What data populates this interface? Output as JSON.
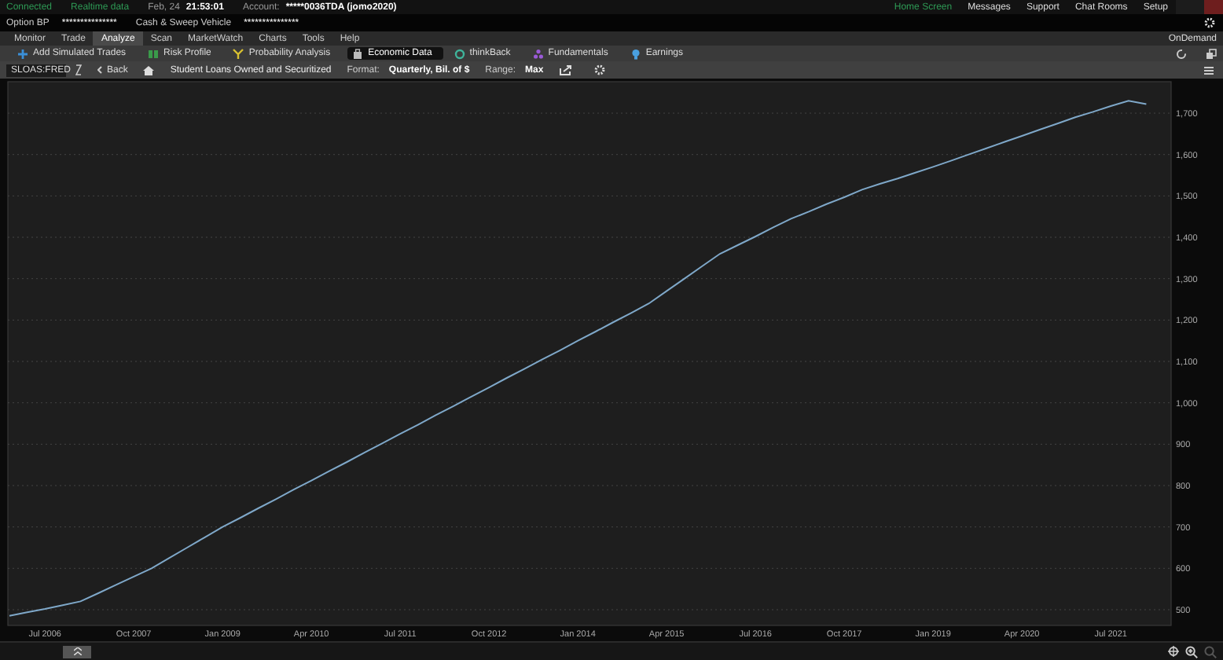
{
  "status_bar": {
    "connection": "Connected",
    "feed": "Realtime data",
    "date": "Feb, 24",
    "time": "21:53:01",
    "account_label": "Account:",
    "account": "*****0036TDA (jomo2020)",
    "links": [
      {
        "label": "Home Screen",
        "selected": true
      },
      {
        "label": "Messages",
        "selected": false
      },
      {
        "label": "Support",
        "selected": false
      },
      {
        "label": "Chat Rooms",
        "selected": false
      },
      {
        "label": "Setup",
        "selected": false
      }
    ]
  },
  "balances": [
    {
      "label": "Option BP",
      "value": "***************"
    },
    {
      "label": "Cash & Sweep Vehicle",
      "value": "***************"
    }
  ],
  "tabs": [
    {
      "label": "Monitor",
      "selected": false
    },
    {
      "label": "Trade",
      "selected": false
    },
    {
      "label": "Analyze",
      "selected": true
    },
    {
      "label": "Scan",
      "selected": false
    },
    {
      "label": "MarketWatch",
      "selected": false
    },
    {
      "label": "Charts",
      "selected": false
    },
    {
      "label": "Tools",
      "selected": false
    },
    {
      "label": "Help",
      "selected": false
    }
  ],
  "on_demand": "OnDemand",
  "subtabs": [
    {
      "label": "Add Simulated Trades",
      "kind": "plus",
      "selected": false
    },
    {
      "label": "Risk Profile",
      "kind": "bars",
      "selected": false
    },
    {
      "label": "Probability Analysis",
      "kind": "fork",
      "selected": false
    },
    {
      "label": "Economic Data",
      "kind": "case",
      "selected": true
    },
    {
      "label": "thinkBack",
      "kind": "ring",
      "selected": false
    },
    {
      "label": "Fundamentals",
      "kind": "dots",
      "selected": false
    },
    {
      "label": "Earnings",
      "kind": "bulb",
      "selected": false
    }
  ],
  "chart_toolbar": {
    "symbol": "SLOAS:FRED",
    "back": "Back",
    "title": "Student Loans Owned and Securitized",
    "format_label": "Format:",
    "format": "Quarterly, Bil. of $",
    "range_label": "Range:",
    "range": "Max"
  },
  "chart": {
    "chart_data": {
      "type": "line",
      "ylim": [
        462,
        1776
      ],
      "yticks": [
        {
          "value": 500,
          "label": "500"
        },
        {
          "value": 600,
          "label": "600"
        },
        {
          "value": 700,
          "label": "700"
        },
        {
          "value": 800,
          "label": "800"
        },
        {
          "value": 900,
          "label": "900"
        },
        {
          "value": 1000,
          "label": "1,000"
        },
        {
          "value": 1100,
          "label": "1,100"
        },
        {
          "value": 1200,
          "label": "1,200"
        },
        {
          "value": 1300,
          "label": "1,300"
        },
        {
          "value": 1400,
          "label": "1,400"
        },
        {
          "value": 1500,
          "label": "1,500"
        },
        {
          "value": 1600,
          "label": "1,600"
        },
        {
          "value": 1700,
          "label": "1,700"
        }
      ],
      "categories": [
        null,
        null,
        "Jul 2006",
        null,
        null,
        null,
        null,
        "Oct 2007",
        null,
        null,
        null,
        null,
        "Jan 2009",
        null,
        null,
        null,
        null,
        "Apr 2010",
        null,
        null,
        null,
        null,
        "Jul 2011",
        null,
        null,
        null,
        null,
        "Oct 2012",
        null,
        null,
        null,
        null,
        "Jan 2014",
        null,
        null,
        null,
        null,
        "Apr 2015",
        null,
        null,
        null,
        null,
        "Jul 2016",
        null,
        null,
        null,
        null,
        "Oct 2017",
        null,
        null,
        null,
        null,
        "Jan 2019",
        null,
        null,
        null,
        null,
        "Apr 2020",
        null,
        null,
        null,
        null,
        "Jul 2021",
        null,
        null
      ],
      "series": [
        {
          "color": "#7fa8c9",
          "values": [
            485,
            494,
            502,
            511,
            520,
            540,
            560,
            580,
            600,
            625,
            650,
            675,
            700,
            722,
            745,
            767,
            790,
            812,
            835,
            857,
            880,
            902,
            925,
            947,
            970,
            992,
            1015,
            1037,
            1060,
            1082,
            1105,
            1127,
            1150,
            1172,
            1195,
            1217,
            1240,
            1270,
            1300,
            1330,
            1360,
            1381,
            1402,
            1424,
            1445,
            1462,
            1480,
            1497,
            1515,
            1529,
            1542,
            1556,
            1570,
            1585,
            1600,
            1615,
            1630,
            1645,
            1660,
            1675,
            1690,
            1703,
            1717,
            1730,
            1722
          ]
        }
      ],
      "grid": true
    }
  }
}
